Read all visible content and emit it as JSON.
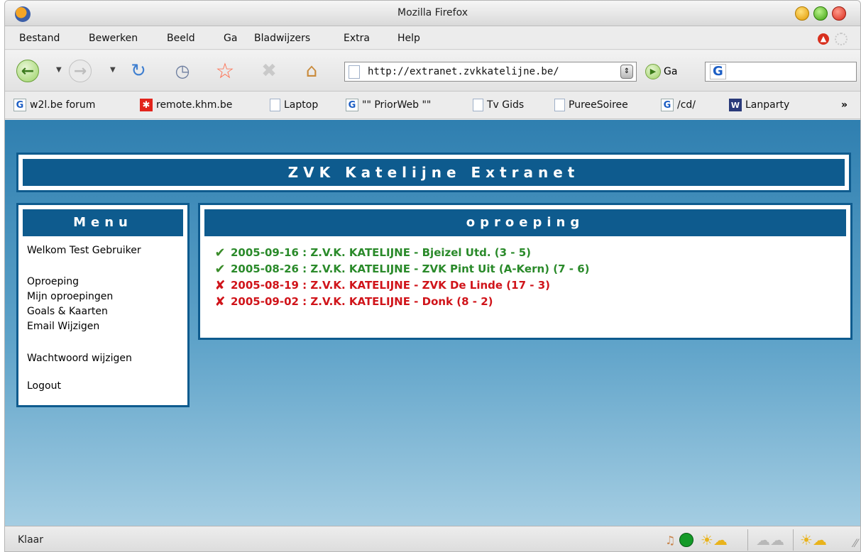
{
  "window": {
    "title": "Mozilla Firefox"
  },
  "menubar": {
    "items": [
      "Bestand",
      "Bewerken",
      "Beeld",
      "Ga",
      "Bladwijzers",
      "Extra",
      "Help"
    ]
  },
  "toolbar": {
    "url": "http://extranet.zvkkatelijne.be/",
    "go_label": "Ga",
    "search_value": "",
    "icons": [
      "back-icon",
      "forward-icon",
      "reload-icon",
      "history-icon",
      "bookmark-star-icon",
      "stop-icon",
      "home-icon"
    ]
  },
  "bookmarks": {
    "items": [
      {
        "label": "w2l.be forum",
        "icon": "google-icon"
      },
      {
        "label": "remote.khm.be",
        "icon": "khm-icon"
      },
      {
        "label": "Laptop",
        "icon": "page-icon"
      },
      {
        "label": "\"\" PriorWeb \"\"",
        "icon": "google-icon"
      },
      {
        "label": "Tv Gids",
        "icon": "page-icon"
      },
      {
        "label": "PureeSoiree",
        "icon": "page-icon"
      },
      {
        "label": "/cd/",
        "icon": "google-icon"
      },
      {
        "label": "Lanparty",
        "icon": "lanparty-icon"
      }
    ],
    "overflow_label": "»"
  },
  "site": {
    "header_title": "ZVK Katelijne Extranet",
    "menu": {
      "title": "Menu",
      "welcome": "Welkom Test Gebruiker",
      "links": [
        "Oproeping",
        "Mijn oproepingen",
        "Goals & Kaarten",
        "Email Wijzigen",
        "Wachtwoord wijzigen",
        "Logout"
      ]
    },
    "main": {
      "title": "oproeping",
      "calls": [
        {
          "text": "2005-09-16 : Z.V.K. KATELIJNE - Bjeizel Utd. (3 - 5)",
          "status": "accepted"
        },
        {
          "text": "2005-08-26 : Z.V.K. KATELIJNE - ZVK Pint Uit (A-Kern) (7 - 6)",
          "status": "accepted"
        },
        {
          "text": "2005-08-19 : Z.V.K. KATELIJNE - ZVK De Linde (17 - 3)",
          "status": "declined"
        },
        {
          "text": "2005-09-02 : Z.V.K. KATELIJNE - Donk (8 - 2)",
          "status": "declined"
        }
      ]
    },
    "colors": {
      "accent": "#0e5b8e",
      "accepted": "#2a8a2a",
      "declined": "#d0141a"
    }
  },
  "statusbar": {
    "text": "Klaar",
    "icons": [
      "audio-icon",
      "green-status-icon",
      "weather-sun-cloud-icon",
      "weather-cloud-icon",
      "weather-sun-icon"
    ]
  }
}
